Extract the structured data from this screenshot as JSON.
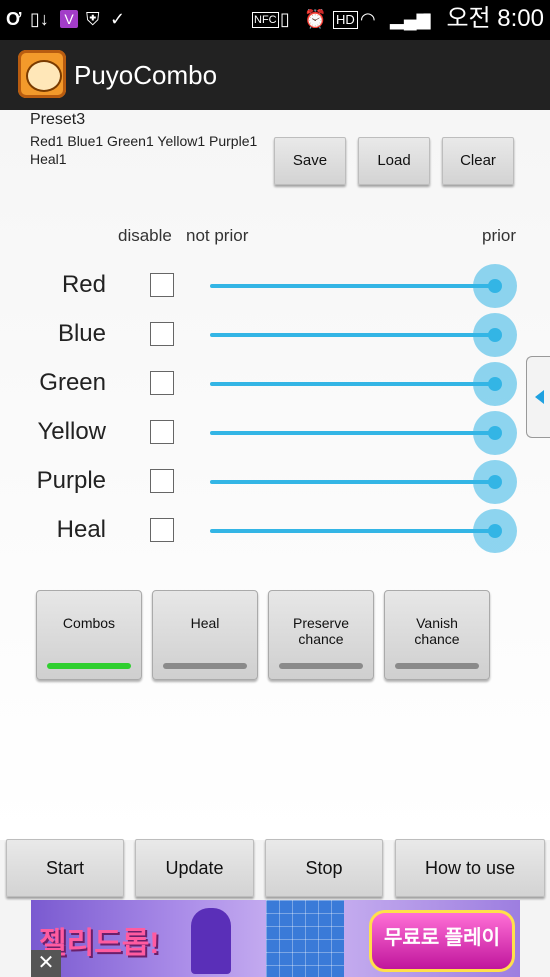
{
  "status_bar": {
    "icons": [
      "skype-icon",
      "phone-download-icon",
      "app-v-icon",
      "shield-icon",
      "clipboard-check-icon",
      "nfc-icon",
      "vibrate-icon",
      "alarm-icon",
      "hd-icon",
      "wifi-icon",
      "signal-icon",
      "battery-icon"
    ],
    "nfc_label": "NFC",
    "hd_label": "HD",
    "v_label": "V",
    "time": "오전 8:00"
  },
  "action_bar": {
    "title": "PuyoCombo"
  },
  "preset": {
    "name": "Preset3",
    "description": "Red1 Blue1 Green1 Yellow1 Purple1 Heal1",
    "save_label": "Save",
    "load_label": "Load",
    "clear_label": "Clear"
  },
  "priority_header": {
    "disable": "disable",
    "not_prior": "not prior",
    "prior": "prior"
  },
  "colors": [
    {
      "label": "Red",
      "disabled": false,
      "priority": 1.0
    },
    {
      "label": "Blue",
      "disabled": false,
      "priority": 1.0
    },
    {
      "label": "Green",
      "disabled": false,
      "priority": 1.0
    },
    {
      "label": "Yellow",
      "disabled": false,
      "priority": 1.0
    },
    {
      "label": "Purple",
      "disabled": false,
      "priority": 1.0
    },
    {
      "label": "Heal",
      "disabled": false,
      "priority": 1.0
    }
  ],
  "toggles": [
    {
      "label": "Combos",
      "on": true
    },
    {
      "label": "Heal",
      "on": false
    },
    {
      "label": "Preserve chance",
      "on": false
    },
    {
      "label": "Vanish chance",
      "on": false
    }
  ],
  "bottom_buttons": {
    "start": "Start",
    "update": "Update",
    "stop": "Stop",
    "how_to_use": "How to use"
  },
  "ad": {
    "title": "젤리드롭!",
    "cta": "무료로 플레이",
    "close": "✕"
  },
  "accent_color": "#33b5e5"
}
